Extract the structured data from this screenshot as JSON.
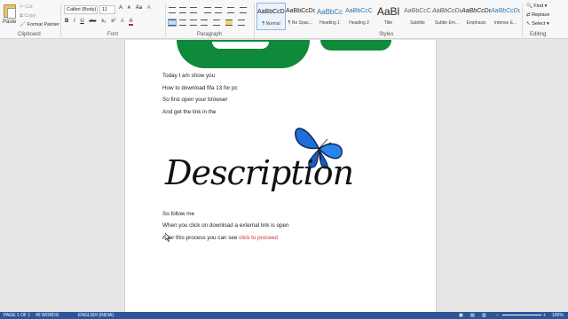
{
  "clipboard": {
    "paste_label": "Paste",
    "cut_label": "Cut",
    "copy_label": "Copy",
    "format_painter_label": "Format Painter",
    "group_label": "Clipboard"
  },
  "font": {
    "family": "Calibri (Body)",
    "size": "11",
    "group_label": "Font",
    "row1": [
      "A",
      "A",
      "Aa",
      "A"
    ],
    "row2": [
      "B",
      "I",
      "U",
      "abc",
      "x₂",
      "x²",
      "A",
      "A"
    ]
  },
  "paragraph": {
    "group_label": "Paragraph"
  },
  "styles": {
    "group_label": "Styles",
    "items": [
      {
        "sample": "AaBbCcDc",
        "name": "¶ Normal"
      },
      {
        "sample": "AaBbCcDc",
        "name": "¶ No Spac..."
      },
      {
        "sample": "AaBbCc",
        "name": "Heading 1"
      },
      {
        "sample": "AaBbCcC",
        "name": "Heading 2"
      },
      {
        "sample": "AaBl",
        "name": "Title"
      },
      {
        "sample": "AaBbCcC",
        "name": "Subtitle"
      },
      {
        "sample": "AaBbCcDc",
        "name": "Subtle Em..."
      },
      {
        "sample": "AaBbCcDc",
        "name": "Emphasis"
      },
      {
        "sample": "AaBbCcDc",
        "name": "Intense E..."
      }
    ]
  },
  "editing": {
    "find_label": "Find",
    "replace_label": "Replace",
    "select_label": "Select",
    "group_label": "Editing"
  },
  "document": {
    "lines": [
      "Today I am show you",
      "How to download fifa 13 for pc",
      "So first open your browser",
      "And get the link in the"
    ],
    "description_text": "Description",
    "follow_line": "So follow me",
    "click_line": "When you click on download a external link is open",
    "after_line_prefix": "After this process you can see ",
    "after_line_link": "click to proceed"
  },
  "status_bar": {
    "page": "PAGE 1 OF 1",
    "words": "45 WORDS",
    "language": "ENGLISH (INDIA)",
    "zoom": "100%"
  }
}
